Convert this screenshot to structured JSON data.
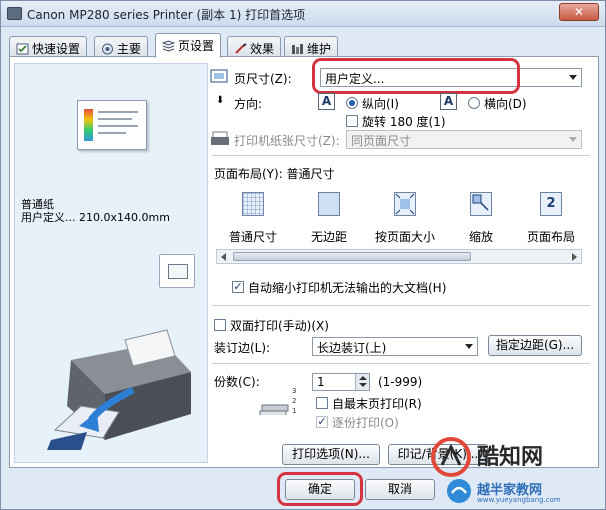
{
  "window": {
    "title": "Canon MP280 series Printer (副本 1) 打印首选项",
    "close_label": "✕"
  },
  "tabs": [
    {
      "label": "快速设置",
      "icon": "quick-setup-icon"
    },
    {
      "label": "主要",
      "icon": "main-icon"
    },
    {
      "label": "页设置",
      "icon": "page-setup-icon"
    },
    {
      "label": "效果",
      "icon": "effects-icon"
    },
    {
      "label": "维护",
      "icon": "maintenance-icon"
    }
  ],
  "preview": {
    "media_type": "普通纸",
    "paper_size_desc": "用户定义... 210.0x140.0mm"
  },
  "page_size": {
    "label": "页尺寸(Z):",
    "value": "用户定义..."
  },
  "orientation": {
    "label": "方向:",
    "portrait_label": "纵向(I)",
    "landscape_label": "横向(D)",
    "selected": "portrait",
    "rotate_label": "旋转 180 度(1)"
  },
  "printer_paper_size": {
    "label": "打印机纸张尺寸(Z):",
    "value": "同页面尺寸"
  },
  "page_layout": {
    "label": "页面布局(Y): 普通尺寸",
    "items": [
      {
        "label": "普通尺寸",
        "icon": "normal-size-icon"
      },
      {
        "label": "无边距",
        "icon": "borderless-icon"
      },
      {
        "label": "按页面大小",
        "icon": "fit-to-page-icon"
      },
      {
        "label": "缩放",
        "icon": "scaled-icon"
      },
      {
        "label": "页面布局",
        "icon": "page-layout-icon",
        "glyph": "2"
      }
    ]
  },
  "auto_reduce": {
    "label": "自动缩小打印机无法输出的大文档(H)",
    "checked": true
  },
  "duplex": {
    "label": "双面打印(手动)(X)",
    "checked": false
  },
  "stapling": {
    "label": "装订边(L):",
    "value": "长边装订(上)",
    "button_label": "指定边距(G)..."
  },
  "copies": {
    "label": "份数(C):",
    "value": "1",
    "range": "(1-999)",
    "last_page_first_label": "自最末页打印(R)",
    "collate_label": "逐份打印(O)"
  },
  "bottom_buttons": {
    "print_options": "打印选项(N)...",
    "stamp": "印记/背景(K)..."
  },
  "footer": {
    "ok": "确定",
    "cancel": "取消"
  },
  "watermark": {
    "brand": "酷知网",
    "site_cn": "越半家教网",
    "site_url": "www.yueyangbang.com"
  },
  "colors": {
    "highlight": "#d3343f",
    "accent": "#1f5fae"
  }
}
